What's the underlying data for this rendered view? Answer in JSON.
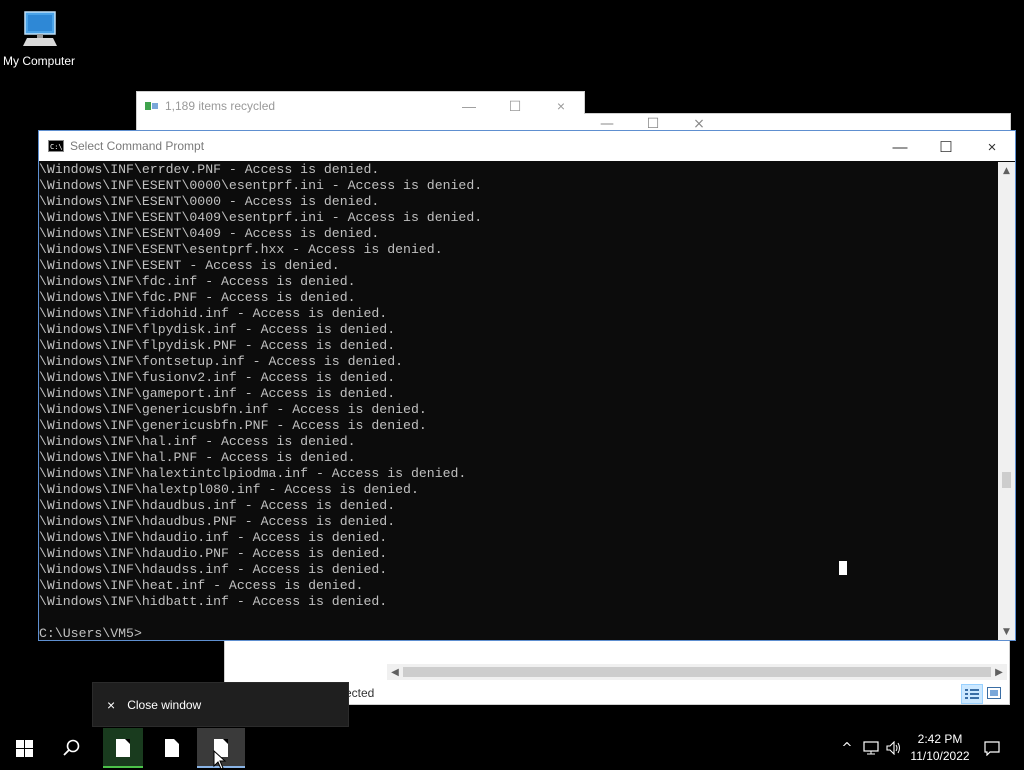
{
  "desktop": {
    "icon_label": "My Computer"
  },
  "recycle_window": {
    "title": "1,189 items recycled"
  },
  "cmd_window": {
    "title": "Select Command Prompt",
    "icon_text": "C:\\",
    "lines": [
      "\\Windows\\INF\\errdev.PNF - Access is denied.",
      "\\Windows\\INF\\ESENT\\0000\\esentprf.ini - Access is denied.",
      "\\Windows\\INF\\ESENT\\0000 - Access is denied.",
      "\\Windows\\INF\\ESENT\\0409\\esentprf.ini - Access is denied.",
      "\\Windows\\INF\\ESENT\\0409 - Access is denied.",
      "\\Windows\\INF\\ESENT\\esentprf.hxx - Access is denied.",
      "\\Windows\\INF\\ESENT - Access is denied.",
      "\\Windows\\INF\\fdc.inf - Access is denied.",
      "\\Windows\\INF\\fdc.PNF - Access is denied.",
      "\\Windows\\INF\\fidohid.inf - Access is denied.",
      "\\Windows\\INF\\flpydisk.inf - Access is denied.",
      "\\Windows\\INF\\flpydisk.PNF - Access is denied.",
      "\\Windows\\INF\\fontsetup.inf - Access is denied.",
      "\\Windows\\INF\\fusionv2.inf - Access is denied.",
      "\\Windows\\INF\\gameport.inf - Access is denied.",
      "\\Windows\\INF\\genericusbfn.inf - Access is denied.",
      "\\Windows\\INF\\genericusbfn.PNF - Access is denied.",
      "\\Windows\\INF\\hal.inf - Access is denied.",
      "\\Windows\\INF\\hal.PNF - Access is denied.",
      "\\Windows\\INF\\halextintclpiodma.inf - Access is denied.",
      "\\Windows\\INF\\halextpl080.inf - Access is denied.",
      "\\Windows\\INF\\hdaudbus.inf - Access is denied.",
      "\\Windows\\INF\\hdaudbus.PNF - Access is denied.",
      "\\Windows\\INF\\hdaudio.inf - Access is denied.",
      "\\Windows\\INF\\hdaudio.PNF - Access is denied.",
      "\\Windows\\INF\\hdaudss.inf - Access is denied.",
      "\\Windows\\INF\\heat.inf - Access is denied.",
      "\\Windows\\INF\\hidbatt.inf - Access is denied.",
      "",
      "C:\\Users\\VM5>"
    ]
  },
  "explorer_window": {
    "status_fragment": "ected"
  },
  "tooltip": {
    "label": "Close window"
  },
  "taskbar": {
    "clock_time": "2:42 PM",
    "clock_date": "11/10/2022"
  },
  "icons": {
    "close": "×",
    "minimize": "—",
    "maximize": "☐",
    "up": "▲",
    "down": "▼",
    "left": "◀",
    "right": "▶",
    "chevron_up": "^"
  }
}
